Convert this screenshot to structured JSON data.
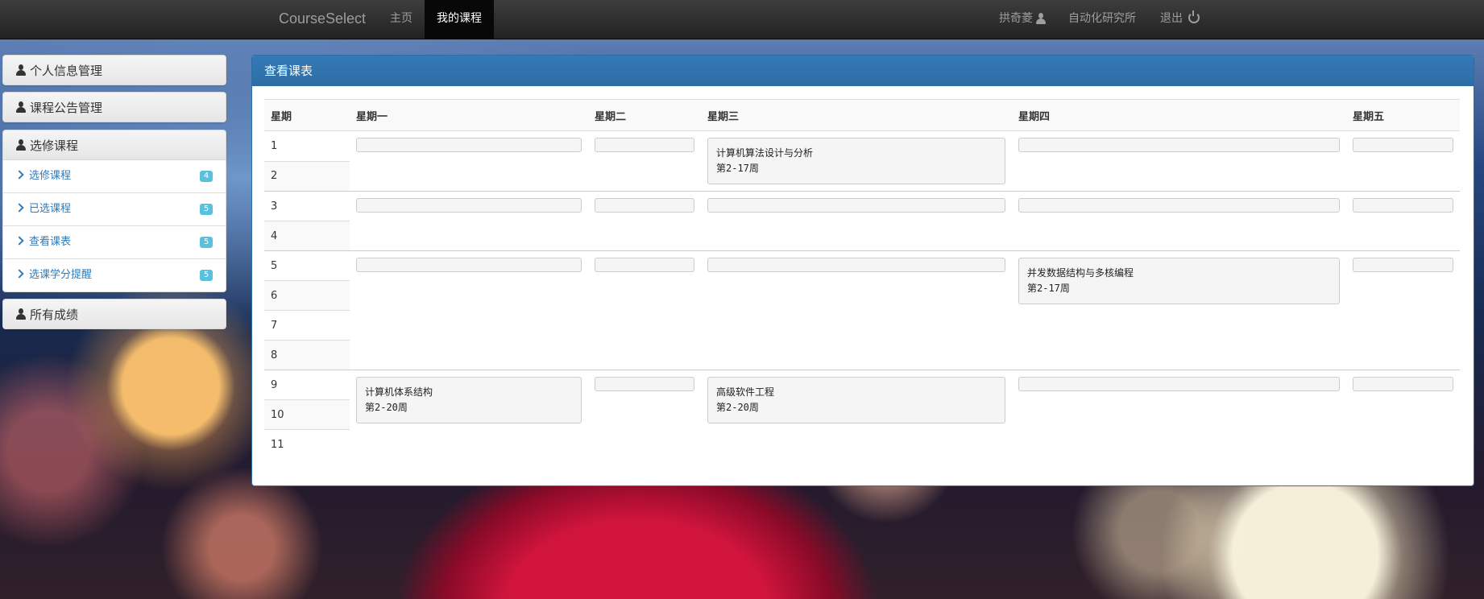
{
  "navbar": {
    "brand": "CourseSelect",
    "home": "主页",
    "my_courses": "我的课程",
    "user": "拱奇菱",
    "institute": "自动化研究所",
    "logout": "退出"
  },
  "sidebar": {
    "personal_info": "个人信息管理",
    "course_notice": "课程公告管理",
    "elective": "选修课程",
    "items": [
      {
        "label": "选修课程",
        "badge": "4"
      },
      {
        "label": "已选课程",
        "badge": "5"
      },
      {
        "label": "查看课表",
        "badge": "5"
      },
      {
        "label": "选课学分提醒",
        "badge": "5"
      }
    ],
    "all_grades": "所有成绩"
  },
  "panel": {
    "title": "查看课表",
    "headers": [
      "星期",
      "星期一",
      "星期二",
      "星期三",
      "星期四",
      "星期五"
    ],
    "periods": [
      "1",
      "2",
      "3",
      "4",
      "5",
      "6",
      "7",
      "8",
      "9",
      "10",
      "11"
    ],
    "courses": {
      "wed_1_2": {
        "name": "计算机算法设计与分析",
        "weeks": "第2-17周"
      },
      "thu_5_8": {
        "name": "并发数据结构与多核编程",
        "weeks": "第2-17周"
      },
      "mon_9_11": {
        "name": "计算机体系结构",
        "weeks": "第2-20周"
      },
      "wed_9_11": {
        "name": "高级软件工程",
        "weeks": "第2-20周"
      }
    }
  }
}
